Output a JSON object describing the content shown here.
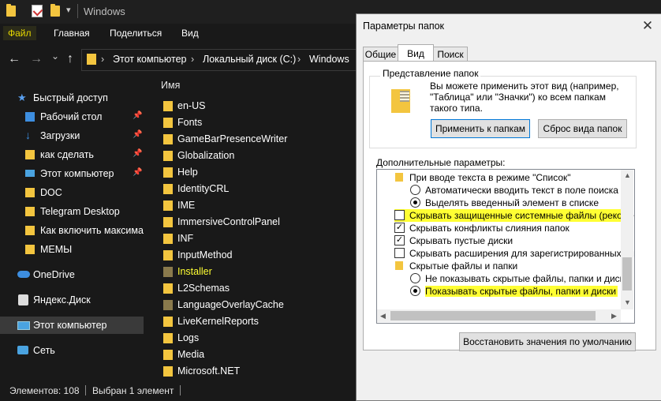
{
  "explorer": {
    "title": "Windows",
    "ribbon": {
      "file": "Файл",
      "home": "Главная",
      "share": "Поделиться",
      "view": "Вид"
    },
    "nav": {
      "back": "←",
      "forward": "→",
      "dropdown": "⌄",
      "up": "↑"
    },
    "breadcrumb": [
      "Этот компьютер",
      "Локальный диск (C:)",
      "Windows"
    ],
    "breadcrumb_sep": "›",
    "nav_items": [
      {
        "label": "Быстрый доступ",
        "icon": "star-icon",
        "pinned": false
      },
      {
        "label": "Рабочий стол",
        "icon": "desktop-icon",
        "pinned": true
      },
      {
        "label": "Загрузки",
        "icon": "download-icon",
        "pinned": true
      },
      {
        "label": "как сделать",
        "icon": "folder-icon",
        "pinned": true
      },
      {
        "label": "Этот компьютер",
        "icon": "computer-icon",
        "pinned": true
      },
      {
        "label": "DOC",
        "icon": "folder-icon",
        "pinned": false
      },
      {
        "label": "Telegram Desktop",
        "icon": "folder-icon",
        "pinned": false
      },
      {
        "label": "Как включить максимал",
        "icon": "folder-icon",
        "pinned": false
      },
      {
        "label": "МЕМЫ",
        "icon": "folder-icon",
        "pinned": false
      },
      {
        "label": "OneDrive",
        "icon": "cloud-icon",
        "pinned": false
      },
      {
        "label": "Яндекс.Диск",
        "icon": "yandex-disk-icon",
        "pinned": false
      },
      {
        "label": "Этот компьютер",
        "icon": "computer-icon",
        "pinned": false
      },
      {
        "label": "Сеть",
        "icon": "network-icon",
        "pinned": false
      }
    ],
    "pin_glyph": "📌",
    "column_name": "Имя",
    "files": [
      "en-US",
      "Fonts",
      "GameBarPresenceWriter",
      "Globalization",
      "Help",
      "IdentityCRL",
      "IME",
      "ImmersiveControlPanel",
      "INF",
      "InputMethod",
      "Installer",
      "L2Schemas",
      "LanguageOverlayCache",
      "LiveKernelReports",
      "Logs",
      "Media",
      "Microsoft.NET"
    ],
    "status": {
      "count": "Элементов: 108",
      "selected": "Выбран 1 элемент"
    }
  },
  "dialog": {
    "title": "Параметры папок",
    "close": "✕",
    "tabs": [
      "Общие",
      "Вид",
      "Поиск"
    ],
    "active_tab": "Вид",
    "group_title": "Представление папок",
    "group_text": "Вы можете применить этот вид (например, \"Таблица\" или \"Значки\") ко всем папкам такого типа.",
    "apply_button": "Применить к папкам",
    "reset_button": "Сброс вида папок",
    "advanced_label": "Дополнительные параметры:",
    "settings": [
      {
        "type": "folder",
        "label": "При вводе текста в режиме \"Список\"",
        "indent": 1
      },
      {
        "type": "radio",
        "checked": false,
        "label": "Автоматически вводить текст в поле поиска",
        "indent": 2
      },
      {
        "type": "radio",
        "checked": true,
        "label": "Выделять введенный элемент в списке",
        "indent": 2
      },
      {
        "type": "checkbox",
        "checked": false,
        "label": "Скрывать защищенные системные файлы (рекомен",
        "indent": 1,
        "highlight": true
      },
      {
        "type": "checkbox",
        "checked": true,
        "label": "Скрывать конфликты слияния папок",
        "indent": 1
      },
      {
        "type": "checkbox",
        "checked": true,
        "label": "Скрывать пустые диски",
        "indent": 1
      },
      {
        "type": "checkbox",
        "checked": false,
        "label": "Скрывать расширения для зарегистрированных типо",
        "indent": 1
      },
      {
        "type": "folder",
        "label": "Скрытые файлы и папки",
        "indent": 1
      },
      {
        "type": "radio",
        "checked": false,
        "label": "Не показывать скрытые файлы, папки и диски",
        "indent": 2
      },
      {
        "type": "radio",
        "checked": true,
        "label": "Показывать скрытые файлы, папки и диски",
        "indent": 2,
        "highlight": true
      }
    ],
    "check_glyph": "✓",
    "scroll_up": "▲",
    "scroll_down": "▼",
    "scroll_left": "◀",
    "scroll_right": "▶",
    "restore_button": "Восстановить значения по умолчанию"
  }
}
